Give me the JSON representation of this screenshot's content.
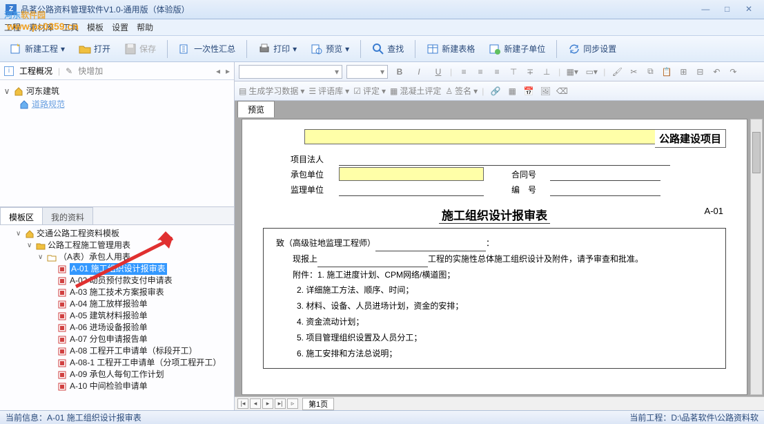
{
  "titlebar": {
    "app_letter": "Z",
    "title": "品茗公路资料管理软件V1.0-通用版（体验版）"
  },
  "watermark": {
    "text_a": "河东",
    "text_b": "软件园",
    "url": "www.pc0359.cn"
  },
  "menubar": {
    "items": [
      "工程",
      "素材库",
      "工具",
      "模板",
      "设置",
      "帮助"
    ]
  },
  "toolbar": {
    "new_proj": "新建工程",
    "open": "打开",
    "save": "保存",
    "summary": "一次性汇总",
    "print": "打印",
    "preview": "预览",
    "search": "查找",
    "new_table": "新建表格",
    "new_unit": "新建子单位",
    "sync": "同步设置"
  },
  "left": {
    "overview": "工程概况",
    "quick_add": "快增加",
    "tree_top": [
      {
        "label": "河东建筑",
        "exp": "∨",
        "ico": "home"
      },
      {
        "label": "道路规范",
        "exp": "",
        "ico": "home-blue",
        "indent": 20,
        "cls": "link"
      }
    ],
    "tabs": {
      "t1": "模板区",
      "t2": "我的资料"
    },
    "tree": [
      {
        "ind": 0,
        "exp": "∨",
        "ico": "home",
        "label": "交通公路工程资料模板"
      },
      {
        "ind": 16,
        "exp": "∨",
        "ico": "folder",
        "label": "公路工程施工管理用表"
      },
      {
        "ind": 32,
        "exp": "∨",
        "ico": "folder-o",
        "label": "（A表）承包人用表"
      },
      {
        "ind": 48,
        "exp": "",
        "ico": "doc-r",
        "label": "A-01 施工组织设计报审表",
        "sel": true
      },
      {
        "ind": 48,
        "exp": "",
        "ico": "doc-r",
        "label": "A-02 动员预付款支付申请表"
      },
      {
        "ind": 48,
        "exp": "",
        "ico": "doc-r",
        "label": "A-03 施工技术方案报审表"
      },
      {
        "ind": 48,
        "exp": "",
        "ico": "doc-r",
        "label": "A-04 施工放样报验单"
      },
      {
        "ind": 48,
        "exp": "",
        "ico": "doc-r",
        "label": "A-05 建筑材料报验单"
      },
      {
        "ind": 48,
        "exp": "",
        "ico": "doc-r",
        "label": "A-06 进场设备报验单"
      },
      {
        "ind": 48,
        "exp": "",
        "ico": "doc-r",
        "label": "A-07 分包申请报告单"
      },
      {
        "ind": 48,
        "exp": "",
        "ico": "doc-r",
        "label": "A-08 工程开工申请单（标段开工）"
      },
      {
        "ind": 48,
        "exp": "",
        "ico": "doc-r",
        "label": "A-08-1 工程开工申请单（分项工程开工）"
      },
      {
        "ind": 48,
        "exp": "",
        "ico": "doc-r",
        "label": "A-09 承包人每旬工作计划"
      },
      {
        "ind": 48,
        "exp": "",
        "ico": "doc-r",
        "label": "A-10 中间检验申请单"
      }
    ]
  },
  "fmt2": {
    "btn1": "生成学习数据",
    "btn2": "评语库",
    "btn3": "评定",
    "btn4": "混凝土评定",
    "btn5": "签名"
  },
  "preview": {
    "tab": "预览",
    "hdr_suffix": "公路建设项目",
    "rows": {
      "r1": "项目法人",
      "r2": "承包单位",
      "r2b": "合同号",
      "r3": "监理单位",
      "r3b": "编　号"
    },
    "title": "施工组织设计报审表",
    "code": "A-01",
    "body": {
      "l1a": "致（高级驻地监理工程师）",
      "l1b": "：",
      "l2a": "现报上",
      "l2b": "工程的实施性总体施工组织设计及附件，请予审查和批准。",
      "l3": "附件：1. 施工进度计划、CPM网络/横道图；",
      "items": [
        "2. 详细施工方法、顺序、时间；",
        "3. 材料、设备、人员进场计划，资金的安排；",
        "4. 资金流动计划；",
        "5. 项目管理组织设置及人员分工；",
        "6. 施工安排和方法总说明；"
      ]
    },
    "page_tab": "第1页"
  },
  "status": {
    "left_a": "当前信息：",
    "left_b": "A-01 施工组织设计报审表",
    "right_a": "当前工程：",
    "right_b": "D:\\品茗软件\\公路资料软"
  }
}
